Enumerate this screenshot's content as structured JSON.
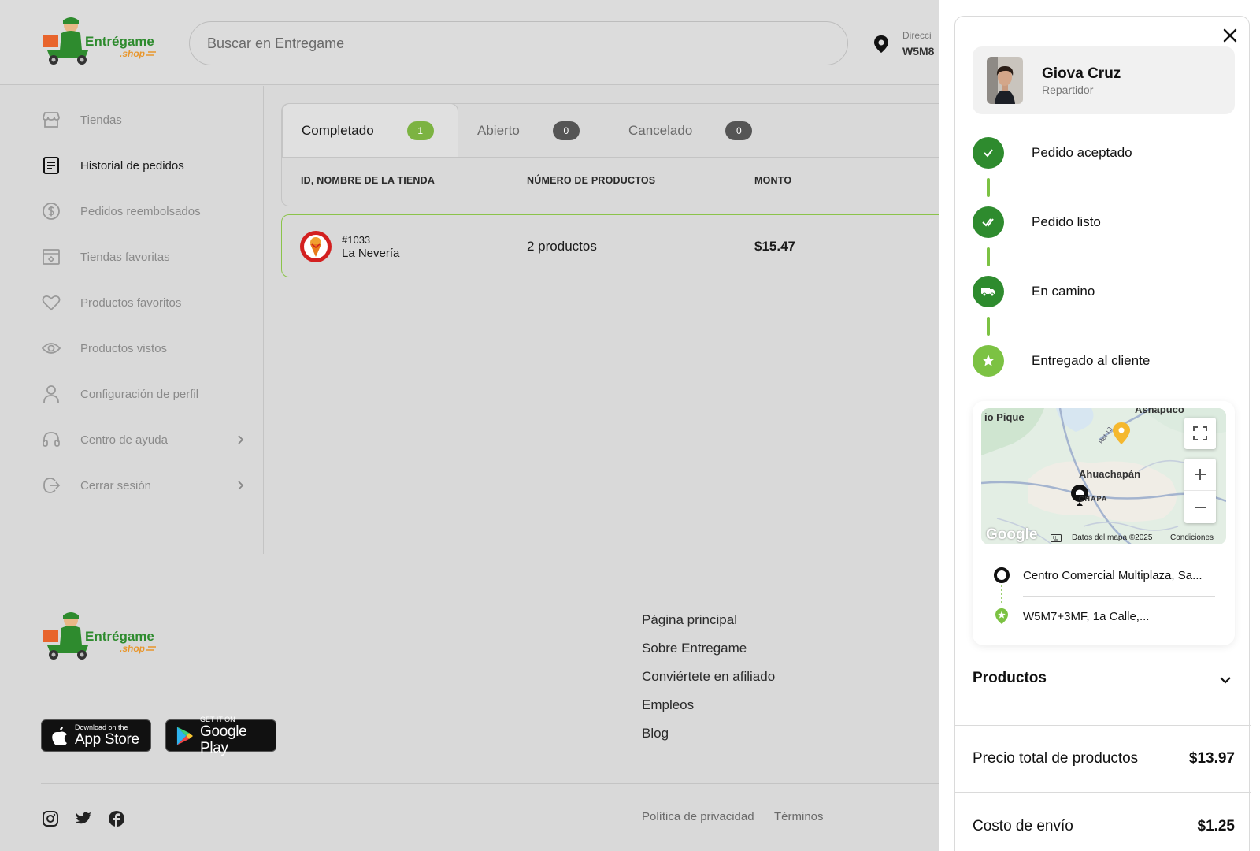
{
  "header": {
    "logo_text": "Entrégame",
    "logo_sub": ".shop",
    "search_placeholder": "Buscar en Entregame",
    "address_label": "Direcci",
    "address_value": "W5M8"
  },
  "sidebar": {
    "items": [
      {
        "label": "Tiendas",
        "icon": "store-icon"
      },
      {
        "label": "Historial de pedidos",
        "icon": "receipt-icon",
        "active": true
      },
      {
        "label": "Pedidos reembolsados",
        "icon": "refund-icon"
      },
      {
        "label": "Tiendas favoritas",
        "icon": "favorite-store-icon"
      },
      {
        "label": "Productos favoritos",
        "icon": "heart-icon"
      },
      {
        "label": "Productos vistos",
        "icon": "eye-icon"
      },
      {
        "label": "Configuración de perfil",
        "icon": "user-icon"
      },
      {
        "label": "Centro de ayuda",
        "icon": "headset-icon",
        "chevron": true
      },
      {
        "label": "Cerrar sesión",
        "icon": "logout-icon",
        "chevron": true
      }
    ]
  },
  "tabs": [
    {
      "label": "Completado",
      "count": "1",
      "color": "#7cb342"
    },
    {
      "label": "Abierto",
      "count": "0",
      "color": "#555555"
    },
    {
      "label": "Cancelado",
      "count": "0",
      "color": "#555555"
    }
  ],
  "table": {
    "headers": [
      "ID, NOMBRE DE LA TIENDA",
      "NÚMERO DE PRODUCTOS",
      "MONTO"
    ],
    "rows": [
      {
        "id": "#1033",
        "store": "La Nevería",
        "products": "2 productos",
        "amount": "$15.47"
      }
    ]
  },
  "footer": {
    "links": [
      "Página principal",
      "Sobre Entregame",
      "Conviértete en afiliado",
      "Empleos",
      "Blog"
    ],
    "app_store": {
      "small": "Download on the",
      "big": "App Store"
    },
    "google_play": {
      "small": "GET IT ON",
      "big": "Google Play"
    },
    "legal": [
      "Política de privacidad",
      "Términos"
    ]
  },
  "drawer": {
    "courier_name": "Giova Cruz",
    "courier_role": "Repartidor",
    "steps": [
      {
        "label": "Pedido aceptado",
        "icon": "check-icon"
      },
      {
        "label": "Pedido listo",
        "icon": "double-check-icon"
      },
      {
        "label": "En camino",
        "icon": "truck-icon"
      },
      {
        "label": "Entregado al cliente",
        "icon": "star-badge-icon"
      }
    ],
    "map": {
      "places": [
        "Ahuachapán",
        "io Pique",
        "Asnapuco",
        "CHAPA"
      ],
      "road": "Ret 13",
      "google": "Google",
      "attribution": "Datos del mapa ©2025",
      "terms": "Condiciones"
    },
    "route": {
      "origin": "Centro Comercial Multiplaza, Sa...",
      "destination": "W5M7+3MF, 1a Calle,..."
    },
    "products_title": "Productos",
    "summary": [
      {
        "label": "Precio total de productos",
        "value": "$13.97"
      },
      {
        "label": "Costo de envío",
        "value": "$1.25"
      }
    ]
  },
  "colors": {
    "brand_green": "#2e8b2e",
    "accent_green": "#7cc243",
    "overlay": "#d9d9d9"
  }
}
